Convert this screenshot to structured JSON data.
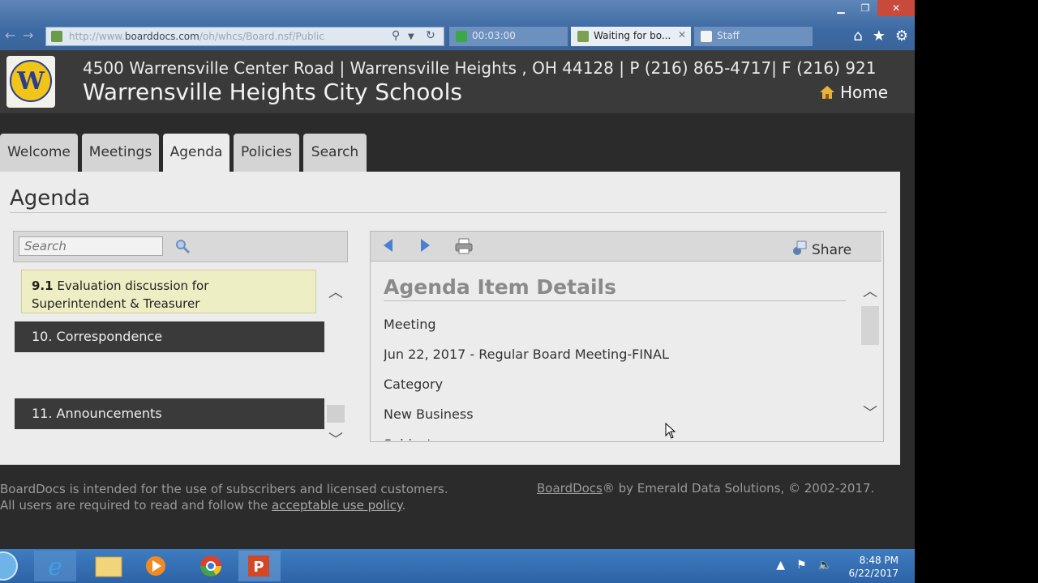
{
  "browser": {
    "url_prefix": "http://www.",
    "url_domain": "boarddocs.com",
    "url_path": "/oh/whcs/Board.nsf/Public",
    "tabs": [
      {
        "label": "00:03:00"
      },
      {
        "label": "Waiting for bo..."
      },
      {
        "label": "Staff"
      }
    ],
    "close_tab_glyph": "✕"
  },
  "site": {
    "address": "4500 Warrensville Center Road | Warrensville Heights , OH 44128 | P (216) 865-4717| F (216) 921",
    "name": "Warrensville Heights City Schools",
    "home_label": "Home"
  },
  "nav": {
    "tabs": [
      {
        "label": "Welcome"
      },
      {
        "label": "Meetings"
      },
      {
        "label": "Agenda"
      },
      {
        "label": "Policies"
      },
      {
        "label": "Search"
      }
    ],
    "active": "Agenda"
  },
  "agenda": {
    "title": "Agenda",
    "search_placeholder": "Search",
    "highlighted_item": {
      "number": "9.1",
      "text": "Evaluation discussion for Superintendent & Treasurer"
    },
    "sections": [
      {
        "label": "10. Correspondence"
      },
      {
        "label": "11. Announcements"
      }
    ]
  },
  "details": {
    "title": "Agenda Item Details",
    "share_label": "Share",
    "fields": [
      {
        "text": "Meeting"
      },
      {
        "text": "Jun 22, 2017 - Regular Board Meeting-FINAL"
      },
      {
        "text": "Category"
      },
      {
        "text": "New Business"
      },
      {
        "text": "Subject"
      }
    ]
  },
  "footer": {
    "line1": "BoardDocs is intended for the use of subscribers and licensed customers.",
    "line2_prefix": "All users are required to read and follow the ",
    "line2_link": "acceptable use policy",
    "line2_suffix": ".",
    "brand_link": "BoardDocs",
    "brand_suffix": "® by Emerald Data Solutions, © 2002-2017."
  },
  "taskbar": {
    "time": "8:48 PM",
    "date": "6/22/2017"
  },
  "colors": {
    "accent_blue": "#4a7fd1",
    "highlight_item": "#eeeec4",
    "section_dark": "#3a3a3a"
  }
}
